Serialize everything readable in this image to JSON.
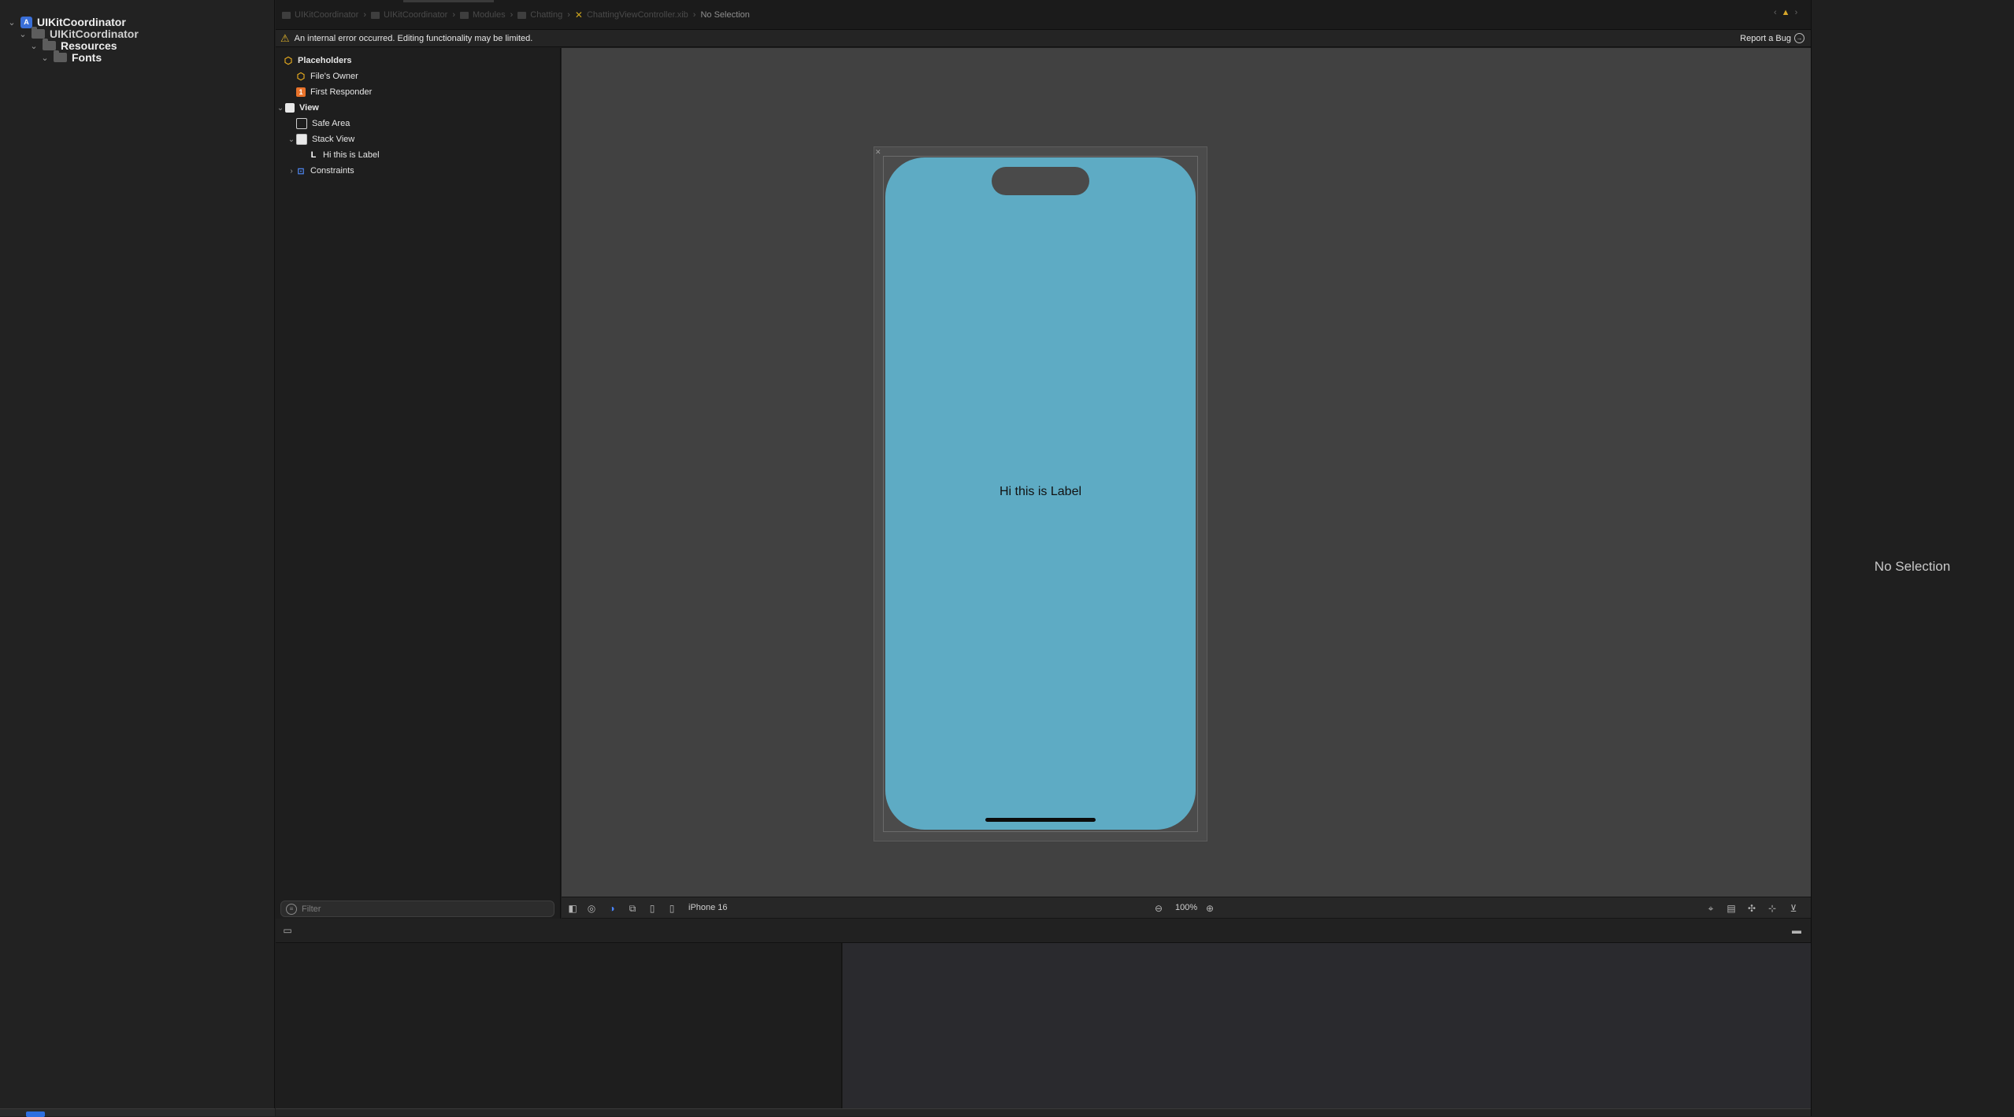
{
  "navigator": {
    "items": [
      {
        "label": "UIKitCoordinator",
        "icon": "xcode-project-icon"
      },
      {
        "label": "UIKitCoordinator",
        "icon": "folder-icon"
      },
      {
        "label": "Resources",
        "icon": "folder-icon"
      },
      {
        "label": "Fonts",
        "icon": "folder-icon"
      }
    ]
  },
  "breadcrumb": {
    "items": [
      "UIKitCoordinator",
      "UIKitCoordinator",
      "Modules",
      "Chatting",
      "ChattingViewController.xib"
    ],
    "current": "No Selection"
  },
  "error_banner": {
    "message": "An internal error occurred. Editing functionality may be limited.",
    "report_label": "Report a Bug"
  },
  "outline": {
    "items": [
      {
        "label": "Placeholders",
        "icon": "placeholder-cube-icon"
      },
      {
        "label": "File's Owner",
        "icon": "placeholder-cube-icon"
      },
      {
        "label": "First Responder",
        "icon": "first-responder-icon"
      },
      {
        "label": "View",
        "icon": "view-icon"
      },
      {
        "label": "Safe Area",
        "icon": "safe-area-icon"
      },
      {
        "label": "Stack View",
        "icon": "stack-view-icon"
      },
      {
        "label": "Hi this is Label",
        "icon": "label-icon"
      },
      {
        "label": "Constraints",
        "icon": "constraints-icon"
      }
    ],
    "filter_placeholder": "Filter"
  },
  "canvas": {
    "label_text": "Hi this is Label",
    "phone_color": "#5eabc4",
    "device": "iPhone 16",
    "zoom": "100%"
  },
  "inspector": {
    "empty_text": "No Selection"
  }
}
